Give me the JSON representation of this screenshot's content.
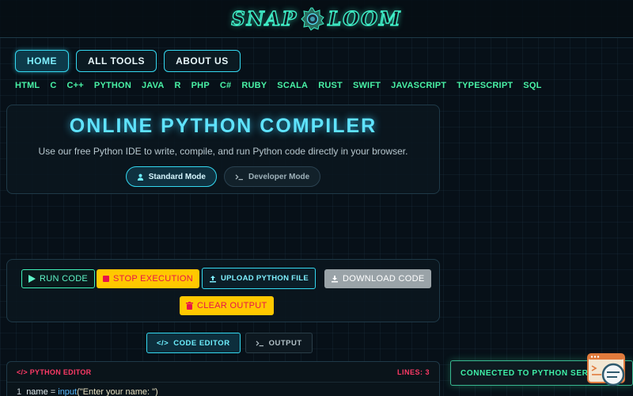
{
  "brand": {
    "left": "SNAP",
    "right": "LOOM"
  },
  "nav": [
    {
      "label": "HOME",
      "active": true
    },
    {
      "label": "ALL TOOLS",
      "active": false
    },
    {
      "label": "ABOUT US",
      "active": false
    }
  ],
  "languages": [
    "HTML",
    "C",
    "C++",
    "PYTHON",
    "JAVA",
    "R",
    "PHP",
    "C#",
    "RUBY",
    "SCALA",
    "RUST",
    "SWIFT",
    "JAVASCRIPT",
    "TYPESCRIPT",
    "SQL"
  ],
  "hero": {
    "title": "ONLINE PYTHON COMPILER",
    "subtitle": "Use our free Python IDE to write, compile, and run Python code directly in your browser.",
    "modes": {
      "standard": "Standard Mode",
      "developer": "Developer Mode"
    }
  },
  "toolbar": {
    "run": "RUN CODE",
    "stop": "STOP EXECUTION",
    "upload": "UPLOAD PYTHON FILE",
    "download": "DOWNLOAD CODE",
    "clear": "CLEAR OUTPUT"
  },
  "tabs": {
    "editor": "CODE EDITOR",
    "output": "OUTPUT"
  },
  "editor": {
    "name": "PYTHON EDITOR",
    "lines": "LINES: 3",
    "line1": {
      "num": "1",
      "var": "name = ",
      "fn": "input",
      "args": "(\"Enter your name: \")"
    }
  },
  "toast": "CONNECTED TO PYTHON SERVER",
  "colors": {
    "accent": "#34d8f0",
    "green": "#49f2a6",
    "warn": "#ffc800",
    "danger": "#e8124a"
  },
  "icons": [
    "gear-logo-icon",
    "user-icon",
    "terminal-icon",
    "play-icon",
    "stop-icon",
    "upload-icon",
    "download-icon",
    "trash-icon",
    "code-icon",
    "chat-bot-icon"
  ]
}
